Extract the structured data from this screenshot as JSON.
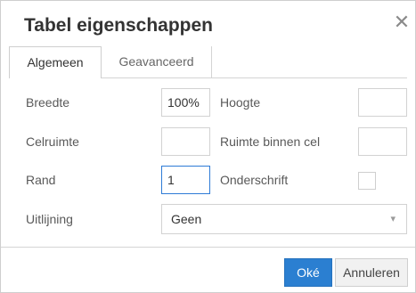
{
  "dialog": {
    "title": "Tabel eigenschappen",
    "close_icon": "close-icon"
  },
  "tabs": [
    {
      "label": "Algemeen",
      "active": true
    },
    {
      "label": "Geavanceerd",
      "active": false
    }
  ],
  "form": {
    "width_label": "Breedte",
    "width_value": "100%",
    "height_label": "Hoogte",
    "height_value": "",
    "cellspacing_label": "Celruimte",
    "cellspacing_value": "",
    "cellpadding_label": "Ruimte binnen cel",
    "cellpadding_value": "",
    "border_label": "Rand",
    "border_value": "1",
    "caption_label": "Onderschrift",
    "caption_checked": false,
    "align_label": "Uitlijning",
    "align_value": "Geen"
  },
  "footer": {
    "ok_label": "Oké",
    "cancel_label": "Annuleren"
  },
  "colors": {
    "primary": "#2b7fd1",
    "focus_border": "#2e7bd6"
  }
}
